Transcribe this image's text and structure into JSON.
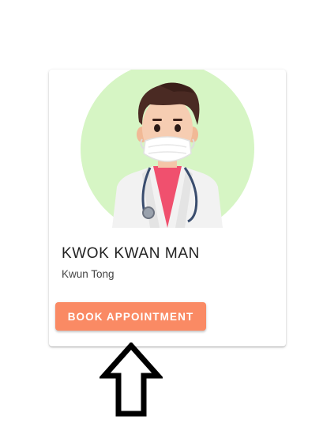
{
  "card": {
    "doctor_name": "KWOK KWAN MAN",
    "location": "Kwun Tong",
    "book_label": "BOOK APPOINTMENT"
  },
  "colors": {
    "button_bg": "#fa8a64",
    "avatar_circle": "#d6f5c4",
    "mask": "#ffffff",
    "shirt": "#f0506e",
    "hair": "#4a2a23"
  },
  "icons": {
    "avatar": "doctor-with-mask-illustration",
    "pointer": "up-arrow-icon"
  }
}
